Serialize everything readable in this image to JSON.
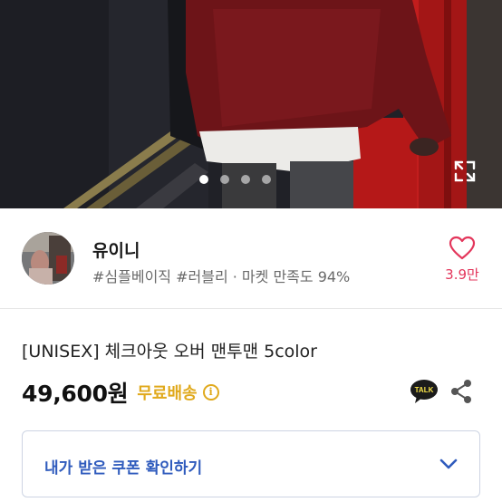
{
  "hero": {
    "photo_alt": "",
    "slides_total": 4,
    "active_slide": 1,
    "expand_icon": "fullscreen-icon"
  },
  "seller": {
    "name": "유이니",
    "meta": "#심플베이직 #러블리 · 마켓 만족도 94%",
    "like_icon": "heart-outline-icon",
    "like_count": "3.9만",
    "accent_color": "#e3365b"
  },
  "product": {
    "title": "[UNISEX] 체크아웃 오버 맨투맨 5color",
    "price": "49,600원",
    "shipping": "무료배송",
    "shipping_color": "#e0a91c",
    "info_icon_glyph": "i",
    "talk_badge": "TALK",
    "share_icon": "share-icon"
  },
  "coupon": {
    "label": "내가 받은 쿠폰 확인하기",
    "label_color": "#2f5bbd",
    "chevron_icon": "chevron-down-icon"
  }
}
